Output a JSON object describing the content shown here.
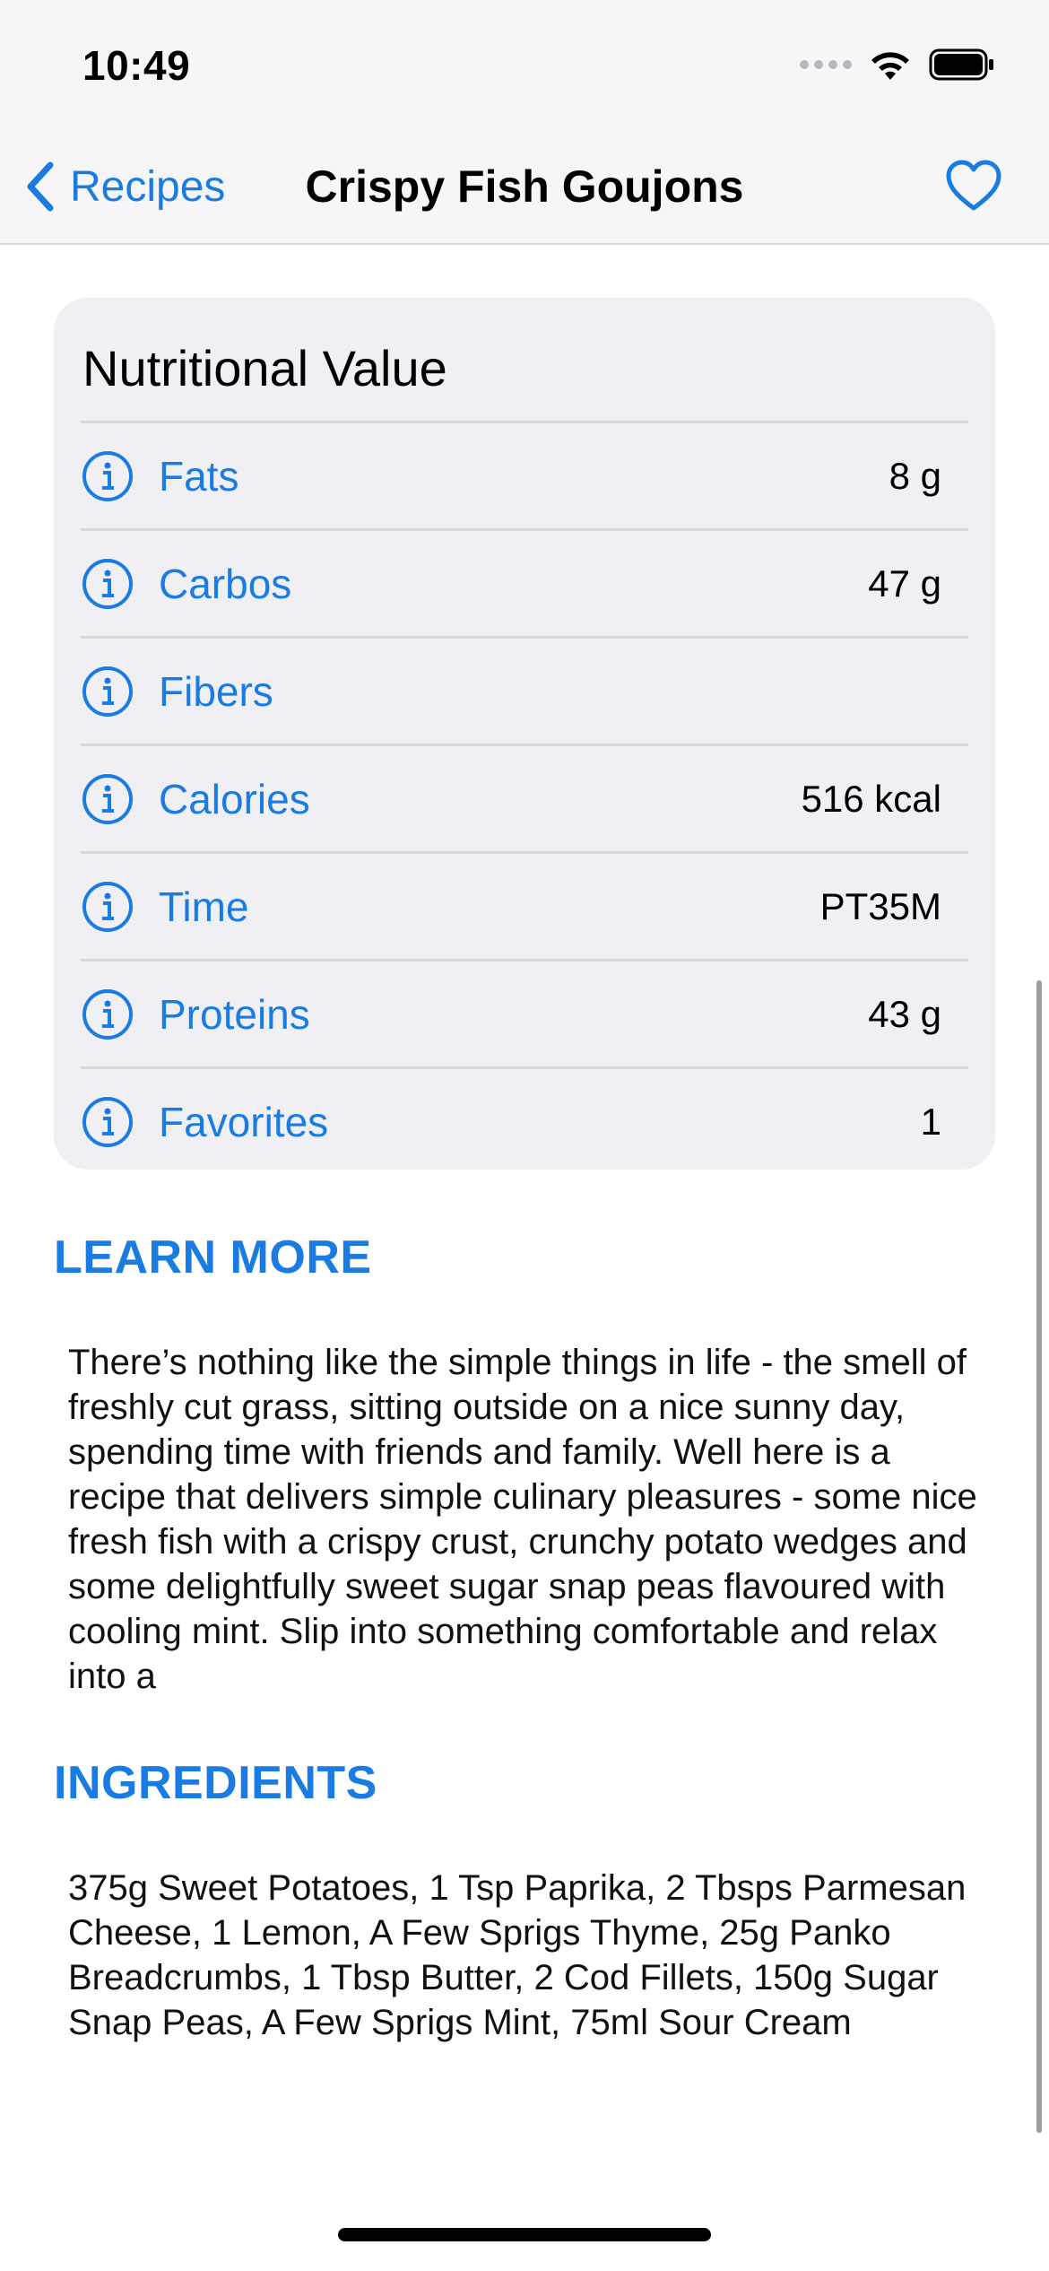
{
  "status_bar": {
    "time": "10:49"
  },
  "nav": {
    "back_label": "Recipes",
    "title": "Crispy Fish Goujons",
    "favorite_icon": "heart-outline-icon"
  },
  "nutrition": {
    "title": "Nutritional Value",
    "rows": [
      {
        "label": "Fats",
        "value": "8 g"
      },
      {
        "label": "Carbos",
        "value": "47 g"
      },
      {
        "label": "Fibers",
        "value": ""
      },
      {
        "label": "Calories",
        "value": "516 kcal"
      },
      {
        "label": "Time",
        "value": "PT35M"
      },
      {
        "label": "Proteins",
        "value": "43 g"
      },
      {
        "label": "Favorites",
        "value": "1"
      }
    ]
  },
  "learn_more": {
    "header": "LEARN MORE",
    "text": "There’s nothing like the simple things in life - the smell of freshly cut grass, sitting outside on a nice sunny day, spending time with friends and family. Well here is a recipe that delivers simple culinary pleasures - some nice fresh fish with a crispy crust, crunchy potato wedges and some delightfully sweet sugar snap peas flavoured with cooling mint. Slip into something comfortable and relax into a"
  },
  "ingredients": {
    "header": "INGREDIENTS",
    "text": "375g Sweet Potatoes, 1 Tsp Paprika, 2 Tbsps Parmesan Cheese, 1 Lemon, A Few Sprigs Thyme, 25g Panko Breadcrumbs, 1 Tbsp Butter, 2 Cod Fillets, 150g Sugar Snap Peas, A Few Sprigs Mint, 75ml Sour Cream"
  },
  "colors": {
    "accent": "#1a7ce2",
    "card_bg": "#efeff4",
    "nav_bg": "#f6f6f8"
  }
}
